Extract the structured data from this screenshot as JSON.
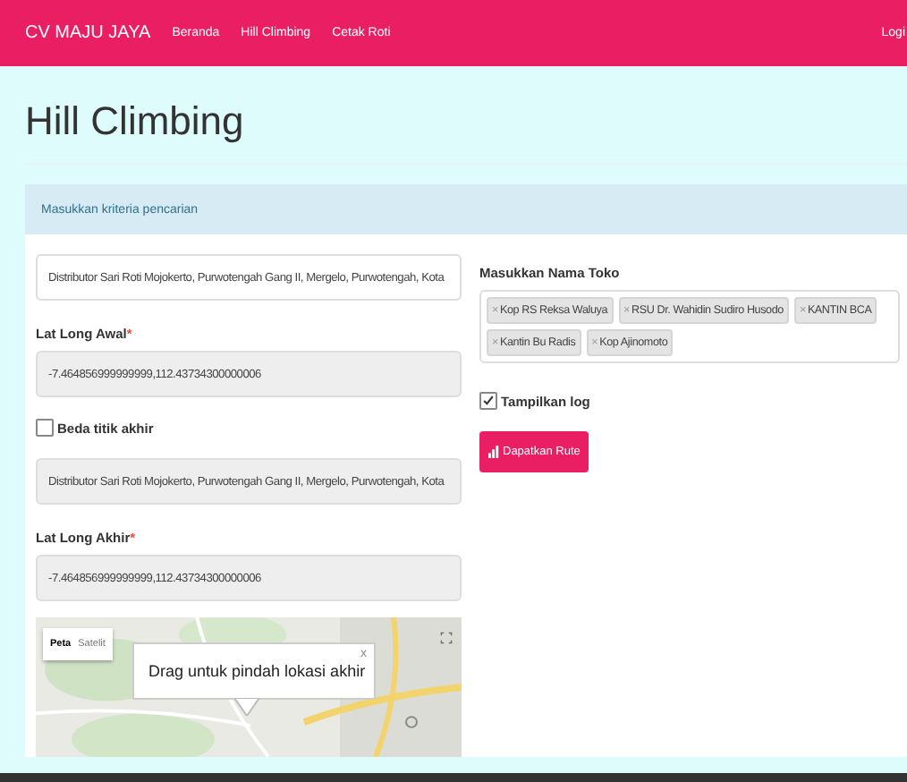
{
  "navbar": {
    "brand": "CV MAJU JAYA",
    "links": [
      {
        "label": "Beranda"
      },
      {
        "label": "Hill Climbing"
      },
      {
        "label": "Cetak Roti"
      }
    ],
    "login": "Logi"
  },
  "page_title": "Hill Climbing",
  "panel": {
    "heading": "Masukkan kriteria pencarian",
    "start_address": {
      "value": "Distributor Sari Roti Mojokerto, Purwotengah Gang II, Mergelo, Purwotengah, Kota",
      "disabled": false
    },
    "start_latlong": {
      "label": "Lat Long Awal",
      "required": "*",
      "value": "-7.464856999999999,112.43734300000006",
      "disabled": true
    },
    "different_end": {
      "label": "Beda titik akhir",
      "checked": false
    },
    "end_address": {
      "value": "Distributor Sari Roti Mojokerto, Purwotengah Gang II, Mergelo, Purwotengah, Kota",
      "disabled": true
    },
    "end_latlong": {
      "label": "Lat Long Akhir",
      "required": "*",
      "value": "-7.464856999999999,112.43734300000006",
      "disabled": true
    },
    "map": {
      "kind": "picture",
      "map_types": [
        {
          "label": "Peta",
          "selected": true
        },
        {
          "label": "Satelit",
          "selected": false
        }
      ],
      "info_window": {
        "text": "Drag untuk pindah lokasi akhir",
        "close": "x"
      }
    },
    "stores": {
      "label": "Masukkan Nama Toko",
      "tags": [
        {
          "remove": "×",
          "label": "Kop RS Reksa Waluya"
        },
        {
          "remove": "×",
          "label": "RSU Dr. Wahidin Sudiro Husodo"
        },
        {
          "remove": "×",
          "label": "KANTIN BCA"
        },
        {
          "remove": "×",
          "label": "Kantin Bu Radis"
        },
        {
          "remove": "×",
          "label": "Kop Ajinomoto"
        }
      ]
    },
    "show_log": {
      "label": "Tampilkan log",
      "checked": true
    },
    "submit": {
      "label": "Dapatkan Rute"
    }
  }
}
